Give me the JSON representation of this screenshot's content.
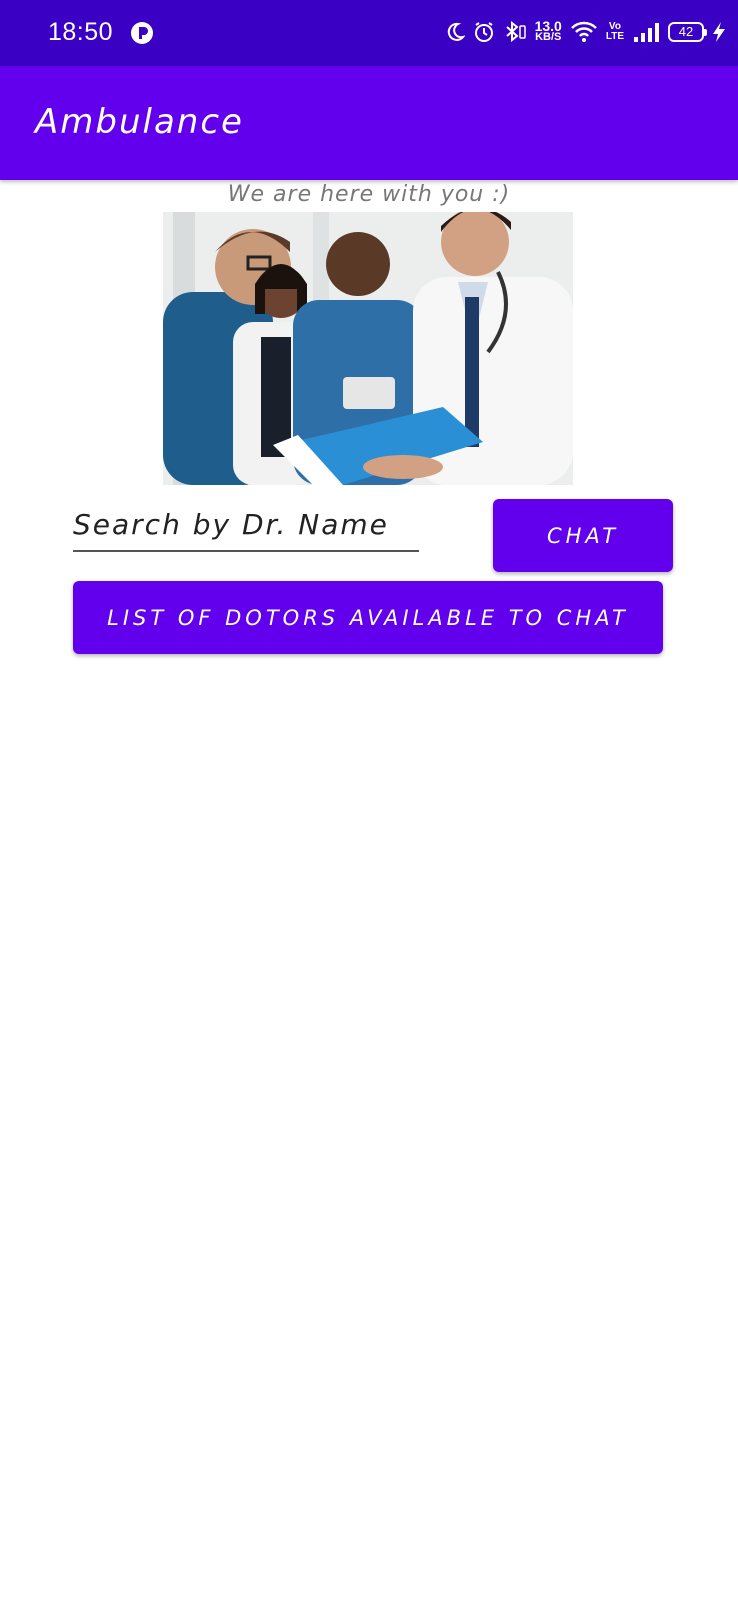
{
  "status_bar": {
    "time": "18:50",
    "net_speed_value": "13.0",
    "net_speed_unit": "KB/S",
    "volte_top": "Vo",
    "volte_bottom": "LTE",
    "battery": "42",
    "icons": [
      "moon-icon",
      "alarm-icon",
      "bluetooth-icon",
      "wifi-icon",
      "signal-icon",
      "charging-icon"
    ],
    "background": "#3a00c4"
  },
  "app_bar": {
    "title": "Ambulance",
    "background": "#6200ee"
  },
  "main": {
    "tagline": "We are here with you :)",
    "search": {
      "placeholder": "Search by Dr. Name",
      "value": ""
    },
    "chat_button_label": "CHAT",
    "list_button_label": "LIST OF DOTORS AVAILABLE TO CHAT",
    "accent_color": "#6200ee"
  }
}
